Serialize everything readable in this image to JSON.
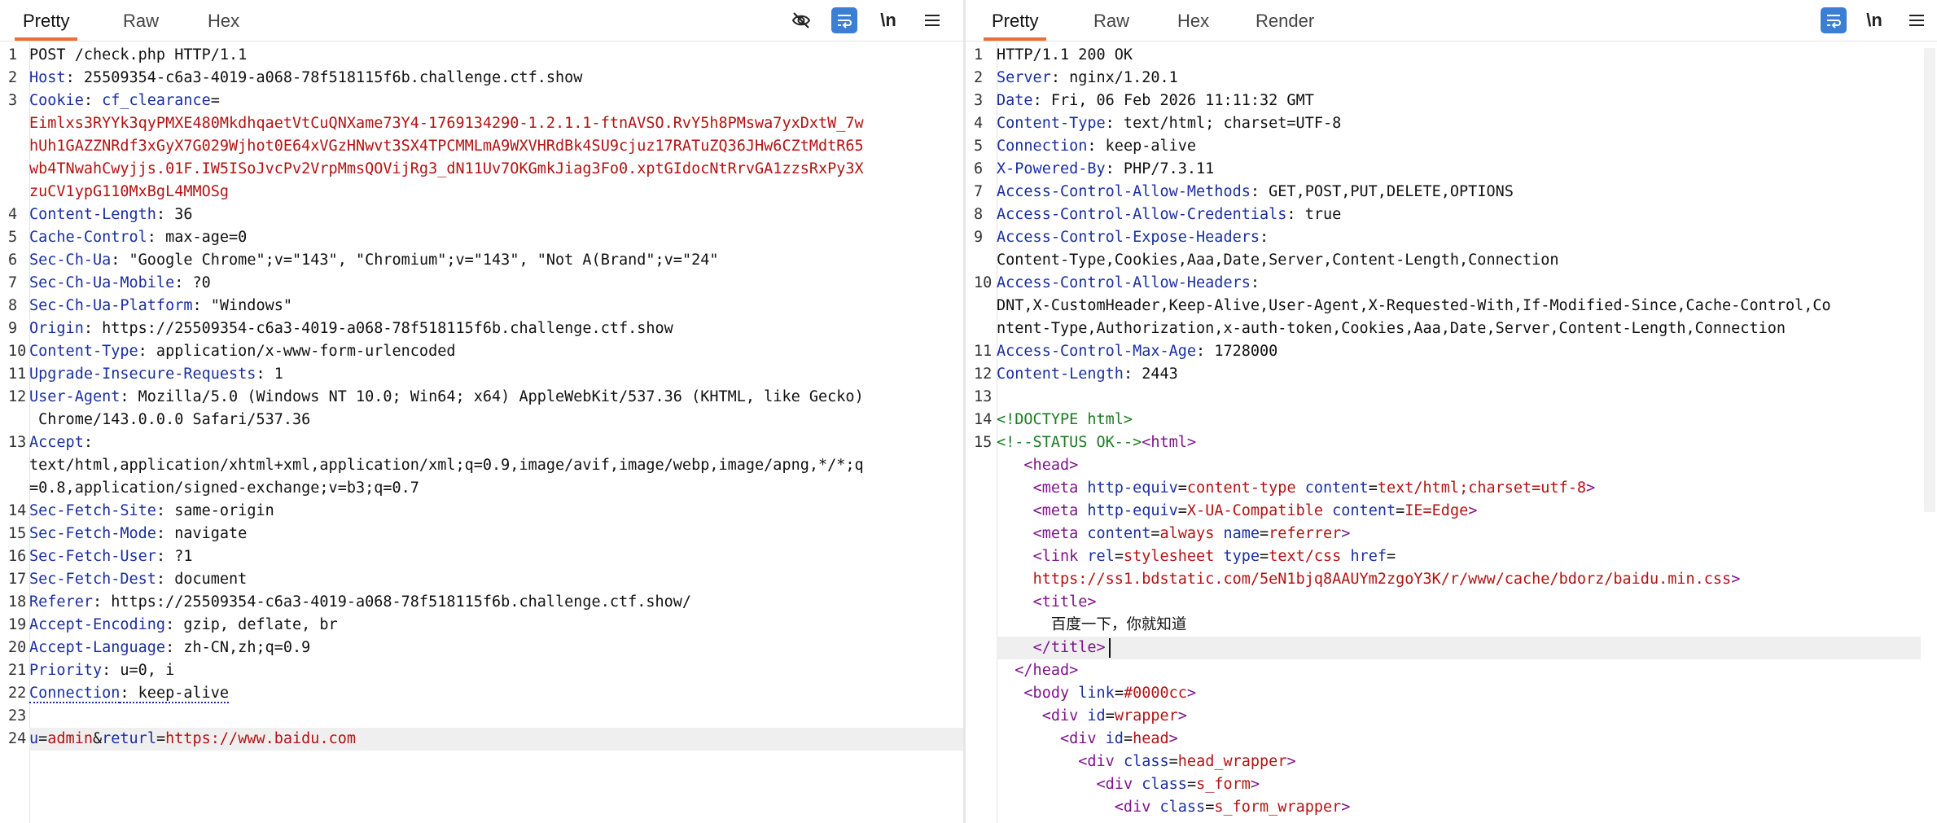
{
  "request": {
    "tabs": [
      "Pretty",
      "Raw",
      "Hex"
    ],
    "active_tab": "Pretty",
    "toolbar": {
      "newline_label": "\\n"
    },
    "line_numbers": [
      "1",
      "2",
      "3",
      "",
      "",
      "",
      "",
      "4",
      "5",
      "6",
      "7",
      "8",
      "9",
      "10",
      "11",
      "12",
      "",
      "13",
      "",
      "",
      "14",
      "15",
      "16",
      "17",
      "18",
      "19",
      "20",
      "21",
      "22",
      "23",
      "24"
    ],
    "lines": [
      {
        "segments": [
          {
            "text": "POST /check.php HTTP/1.1",
            "cls": ""
          }
        ]
      },
      {
        "segments": [
          {
            "text": "Host",
            "cls": "k"
          },
          {
            "text": ": 25509354-c6a3-4019-a068-78f518115f6b.challenge.ctf.show",
            "cls": ""
          }
        ]
      },
      {
        "segments": [
          {
            "text": "Cookie",
            "cls": "k"
          },
          {
            "text": ": ",
            "cls": ""
          },
          {
            "text": "cf_clearance",
            "cls": "k"
          },
          {
            "text": "=",
            "cls": ""
          }
        ]
      },
      {
        "segments": [
          {
            "text": "Eimlxs3RYYk3qyPMXE480MkdhqaetVtCuQNXame73Y4-1769134290-1.2.1.1-ftnAVSO.RvY5h8PMswa7yxDxtW_7w",
            "cls": "r"
          }
        ]
      },
      {
        "segments": [
          {
            "text": "hUh1GAZZNRdf3xGyX7G029Wjhot0E64xVGzHNwvt3SX4TPCMMLmA9WXVHRdBk4SU9cjuz17RATuZQ36JHw6CZtMdtR65",
            "cls": "r"
          }
        ]
      },
      {
        "segments": [
          {
            "text": "wb4TNwahCwyjjs.01F.IW5ISoJvcPv2VrpMmsQOVijRg3_dN11Uv7OKGmkJiag3Fo0.xptGIdocNtRrvGA1zzsRxPy3X",
            "cls": "r"
          }
        ]
      },
      {
        "segments": [
          {
            "text": "zuCV1ypG110MxBgL4MMOSg",
            "cls": "r"
          }
        ]
      },
      {
        "segments": [
          {
            "text": "Content-Length",
            "cls": "k"
          },
          {
            "text": ": 36",
            "cls": ""
          }
        ]
      },
      {
        "segments": [
          {
            "text": "Cache-Control",
            "cls": "k"
          },
          {
            "text": ": max-age=0",
            "cls": ""
          }
        ]
      },
      {
        "segments": [
          {
            "text": "Sec-Ch-Ua",
            "cls": "k"
          },
          {
            "text": ": \"Google Chrome\";v=\"143\", \"Chromium\";v=\"143\", \"Not A(Brand\";v=\"24\"",
            "cls": ""
          }
        ]
      },
      {
        "segments": [
          {
            "text": "Sec-Ch-Ua-Mobile",
            "cls": "k"
          },
          {
            "text": ": ?0",
            "cls": ""
          }
        ]
      },
      {
        "segments": [
          {
            "text": "Sec-Ch-Ua-Platform",
            "cls": "k"
          },
          {
            "text": ": \"Windows\"",
            "cls": ""
          }
        ]
      },
      {
        "segments": [
          {
            "text": "Origin",
            "cls": "k"
          },
          {
            "text": ": https://25509354-c6a3-4019-a068-78f518115f6b.challenge.ctf.show",
            "cls": ""
          }
        ]
      },
      {
        "segments": [
          {
            "text": "Content-Type",
            "cls": "k"
          },
          {
            "text": ": application/x-www-form-urlencoded",
            "cls": ""
          }
        ]
      },
      {
        "segments": [
          {
            "text": "Upgrade-Insecure-Requests",
            "cls": "k"
          },
          {
            "text": ": 1",
            "cls": ""
          }
        ]
      },
      {
        "segments": [
          {
            "text": "User-Agent",
            "cls": "k"
          },
          {
            "text": ": Mozilla/5.0 (Windows NT 10.0; Win64; x64) AppleWebKit/537.36 (KHTML, like Gecko)",
            "cls": ""
          }
        ]
      },
      {
        "segments": [
          {
            "text": " Chrome/143.0.0.0 Safari/537.36",
            "cls": ""
          }
        ]
      },
      {
        "segments": [
          {
            "text": "Accept",
            "cls": "k"
          },
          {
            "text": ":",
            "cls": ""
          }
        ]
      },
      {
        "segments": [
          {
            "text": "text/html,application/xhtml+xml,application/xml;q=0.9,image/avif,image/webp,image/apng,*/*;q",
            "cls": ""
          }
        ]
      },
      {
        "segments": [
          {
            "text": "=0.8,application/signed-exchange;v=b3;q=0.7",
            "cls": ""
          }
        ]
      },
      {
        "segments": [
          {
            "text": "Sec-Fetch-Site",
            "cls": "k"
          },
          {
            "text": ": same-origin",
            "cls": ""
          }
        ]
      },
      {
        "segments": [
          {
            "text": "Sec-Fetch-Mode",
            "cls": "k"
          },
          {
            "text": ": navigate",
            "cls": ""
          }
        ]
      },
      {
        "segments": [
          {
            "text": "Sec-Fetch-User",
            "cls": "k"
          },
          {
            "text": ": ?1",
            "cls": ""
          }
        ]
      },
      {
        "segments": [
          {
            "text": "Sec-Fetch-Dest",
            "cls": "k"
          },
          {
            "text": ": document",
            "cls": ""
          }
        ]
      },
      {
        "segments": [
          {
            "text": "Referer",
            "cls": "k"
          },
          {
            "text": ": https://25509354-c6a3-4019-a068-78f518115f6b.challenge.ctf.show/",
            "cls": ""
          }
        ]
      },
      {
        "segments": [
          {
            "text": "Accept-Encoding",
            "cls": "k"
          },
          {
            "text": ": gzip, deflate, br",
            "cls": ""
          }
        ]
      },
      {
        "segments": [
          {
            "text": "Accept-Language",
            "cls": "k"
          },
          {
            "text": ": zh-CN,zh;q=0.9",
            "cls": ""
          }
        ]
      },
      {
        "segments": [
          {
            "text": "Priority",
            "cls": "k"
          },
          {
            "text": ": u=0, i",
            "cls": ""
          }
        ]
      },
      {
        "segments": [
          {
            "text": "Connection",
            "cls": "k dotted"
          },
          {
            "text": ": keep-alive",
            "cls": "dotted"
          }
        ]
      },
      {
        "segments": [
          {
            "text": "",
            "cls": ""
          }
        ]
      },
      {
        "highlight": true,
        "segments": [
          {
            "text": "u",
            "cls": "k"
          },
          {
            "text": "=",
            "cls": ""
          },
          {
            "text": "admin",
            "cls": "r"
          },
          {
            "text": "&",
            "cls": ""
          },
          {
            "text": "returl",
            "cls": "k"
          },
          {
            "text": "=",
            "cls": ""
          },
          {
            "text": "https://www.baidu.com",
            "cls": "r"
          }
        ]
      }
    ]
  },
  "response": {
    "tabs": [
      "Pretty",
      "Raw",
      "Hex",
      "Render"
    ],
    "active_tab": "Pretty",
    "toolbar": {
      "newline_label": "\\n"
    },
    "line_numbers": [
      "1",
      "2",
      "3",
      "4",
      "5",
      "6",
      "7",
      "8",
      "9",
      "",
      "10",
      "",
      "",
      "11",
      "12",
      "13",
      "14",
      "15",
      "",
      "",
      "",
      "",
      "",
      "",
      "",
      "",
      "",
      "",
      "",
      "",
      "",
      "",
      ""
    ],
    "lines": [
      {
        "segments": [
          {
            "text": "HTTP/1.1 200 OK",
            "cls": ""
          }
        ]
      },
      {
        "segments": [
          {
            "text": "Server",
            "cls": "k"
          },
          {
            "text": ": nginx/1.20.1",
            "cls": ""
          }
        ]
      },
      {
        "segments": [
          {
            "text": "Date",
            "cls": "k"
          },
          {
            "text": ": Fri, 06 Feb 2026 11:11:32 GMT",
            "cls": ""
          }
        ]
      },
      {
        "segments": [
          {
            "text": "Content-Type",
            "cls": "k"
          },
          {
            "text": ": text/html; charset=UTF-8",
            "cls": ""
          }
        ]
      },
      {
        "segments": [
          {
            "text": "Connection",
            "cls": "k"
          },
          {
            "text": ": keep-alive",
            "cls": ""
          }
        ]
      },
      {
        "segments": [
          {
            "text": "X-Powered-By",
            "cls": "k"
          },
          {
            "text": ": PHP/7.3.11",
            "cls": ""
          }
        ]
      },
      {
        "segments": [
          {
            "text": "Access-Control-Allow-Methods",
            "cls": "k"
          },
          {
            "text": ": GET,POST,PUT,DELETE,OPTIONS",
            "cls": ""
          }
        ]
      },
      {
        "segments": [
          {
            "text": "Access-Control-Allow-Credentials",
            "cls": "k"
          },
          {
            "text": ": true",
            "cls": ""
          }
        ]
      },
      {
        "segments": [
          {
            "text": "Access-Control-Expose-Headers",
            "cls": "k"
          },
          {
            "text": ":",
            "cls": ""
          }
        ]
      },
      {
        "segments": [
          {
            "text": "Content-Type,Cookies,Aaa,Date,Server,Content-Length,Connection",
            "cls": ""
          }
        ]
      },
      {
        "segments": [
          {
            "text": "Access-Control-Allow-Headers",
            "cls": "k"
          },
          {
            "text": ":",
            "cls": ""
          }
        ]
      },
      {
        "segments": [
          {
            "text": "DNT,X-CustomHeader,Keep-Alive,User-Agent,X-Requested-With,If-Modified-Since,Cache-Control,Co",
            "cls": ""
          }
        ]
      },
      {
        "segments": [
          {
            "text": "ntent-Type,Authorization,x-auth-token,Cookies,Aaa,Date,Server,Content-Length,Connection",
            "cls": ""
          }
        ]
      },
      {
        "segments": [
          {
            "text": "Access-Control-Max-Age",
            "cls": "k"
          },
          {
            "text": ": 1728000",
            "cls": ""
          }
        ]
      },
      {
        "segments": [
          {
            "text": "Content-Length",
            "cls": "k"
          },
          {
            "text": ": 2443",
            "cls": ""
          }
        ]
      },
      {
        "segments": [
          {
            "text": "",
            "cls": ""
          }
        ]
      },
      {
        "segments": [
          {
            "text": "<!DOCTYPE html>",
            "cls": "c"
          }
        ]
      },
      {
        "segments": [
          {
            "text": "<!--STATUS OK-->",
            "cls": "c"
          },
          {
            "text": "<html>",
            "cls": "t"
          }
        ]
      },
      {
        "segments": [
          {
            "text": "   ",
            "cls": ""
          },
          {
            "text": "<head>",
            "cls": "t"
          }
        ]
      },
      {
        "segments": [
          {
            "text": "    ",
            "cls": ""
          },
          {
            "text": "<meta ",
            "cls": "t"
          },
          {
            "text": "http-equiv",
            "cls": "a"
          },
          {
            "text": "=",
            "cls": ""
          },
          {
            "text": "content-type ",
            "cls": "v"
          },
          {
            "text": "content",
            "cls": "a"
          },
          {
            "text": "=",
            "cls": ""
          },
          {
            "text": "text/html;charset=utf-8",
            "cls": "v"
          },
          {
            "text": ">",
            "cls": "t"
          }
        ]
      },
      {
        "segments": [
          {
            "text": "    ",
            "cls": ""
          },
          {
            "text": "<meta ",
            "cls": "t"
          },
          {
            "text": "http-equiv",
            "cls": "a"
          },
          {
            "text": "=",
            "cls": ""
          },
          {
            "text": "X-UA-Compatible ",
            "cls": "v"
          },
          {
            "text": "content",
            "cls": "a"
          },
          {
            "text": "=",
            "cls": ""
          },
          {
            "text": "IE=Edge",
            "cls": "v"
          },
          {
            "text": ">",
            "cls": "t"
          }
        ]
      },
      {
        "segments": [
          {
            "text": "    ",
            "cls": ""
          },
          {
            "text": "<meta ",
            "cls": "t"
          },
          {
            "text": "content",
            "cls": "a"
          },
          {
            "text": "=",
            "cls": ""
          },
          {
            "text": "always ",
            "cls": "v"
          },
          {
            "text": "name",
            "cls": "a"
          },
          {
            "text": "=",
            "cls": ""
          },
          {
            "text": "referrer",
            "cls": "v"
          },
          {
            "text": ">",
            "cls": "t"
          }
        ]
      },
      {
        "segments": [
          {
            "text": "    ",
            "cls": ""
          },
          {
            "text": "<link ",
            "cls": "t"
          },
          {
            "text": "rel",
            "cls": "a"
          },
          {
            "text": "=",
            "cls": ""
          },
          {
            "text": "stylesheet ",
            "cls": "v"
          },
          {
            "text": "type",
            "cls": "a"
          },
          {
            "text": "=",
            "cls": ""
          },
          {
            "text": "text/css ",
            "cls": "v"
          },
          {
            "text": "href",
            "cls": "a"
          },
          {
            "text": "=",
            "cls": ""
          }
        ]
      },
      {
        "segments": [
          {
            "text": "    ",
            "cls": ""
          },
          {
            "text": "https://ss1.bdstatic.com/5eN1bjq8AAUYm2zgoY3K/r/www/cache/bdorz/baidu.min.css",
            "cls": "v"
          },
          {
            "text": ">",
            "cls": "t"
          }
        ]
      },
      {
        "segments": [
          {
            "text": "    ",
            "cls": ""
          },
          {
            "text": "<title>",
            "cls": "t"
          }
        ]
      },
      {
        "segments": [
          {
            "text": "      百度一下，你就知道",
            "cls": ""
          }
        ]
      },
      {
        "highlight": true,
        "caret": true,
        "segments": [
          {
            "text": "    ",
            "cls": ""
          },
          {
            "text": "</title>",
            "cls": "t"
          }
        ]
      },
      {
        "segments": [
          {
            "text": "  ",
            "cls": ""
          },
          {
            "text": "</head>",
            "cls": "t"
          }
        ]
      },
      {
        "segments": [
          {
            "text": "   ",
            "cls": ""
          },
          {
            "text": "<body ",
            "cls": "t"
          },
          {
            "text": "link",
            "cls": "a"
          },
          {
            "text": "=",
            "cls": ""
          },
          {
            "text": "#0000cc",
            "cls": "v"
          },
          {
            "text": ">",
            "cls": "t"
          }
        ]
      },
      {
        "segments": [
          {
            "text": "     ",
            "cls": ""
          },
          {
            "text": "<div ",
            "cls": "t"
          },
          {
            "text": "id",
            "cls": "a"
          },
          {
            "text": "=",
            "cls": ""
          },
          {
            "text": "wrapper",
            "cls": "v"
          },
          {
            "text": ">",
            "cls": "t"
          }
        ]
      },
      {
        "segments": [
          {
            "text": "       ",
            "cls": ""
          },
          {
            "text": "<div ",
            "cls": "t"
          },
          {
            "text": "id",
            "cls": "a"
          },
          {
            "text": "=",
            "cls": ""
          },
          {
            "text": "head",
            "cls": "v"
          },
          {
            "text": ">",
            "cls": "t"
          }
        ]
      },
      {
        "segments": [
          {
            "text": "         ",
            "cls": ""
          },
          {
            "text": "<div ",
            "cls": "t"
          },
          {
            "text": "class",
            "cls": "a"
          },
          {
            "text": "=",
            "cls": ""
          },
          {
            "text": "head_wrapper",
            "cls": "v"
          },
          {
            "text": ">",
            "cls": "t"
          }
        ]
      },
      {
        "segments": [
          {
            "text": "           ",
            "cls": ""
          },
          {
            "text": "<div ",
            "cls": "t"
          },
          {
            "text": "class",
            "cls": "a"
          },
          {
            "text": "=",
            "cls": ""
          },
          {
            "text": "s_form",
            "cls": "v"
          },
          {
            "text": ">",
            "cls": "t"
          }
        ]
      },
      {
        "segments": [
          {
            "text": "             ",
            "cls": ""
          },
          {
            "text": "<div ",
            "cls": "t"
          },
          {
            "text": "class",
            "cls": "a"
          },
          {
            "text": "=",
            "cls": ""
          },
          {
            "text": "s_form_wrapper",
            "cls": "v"
          },
          {
            "text": ">",
            "cls": "t"
          }
        ]
      }
    ]
  }
}
